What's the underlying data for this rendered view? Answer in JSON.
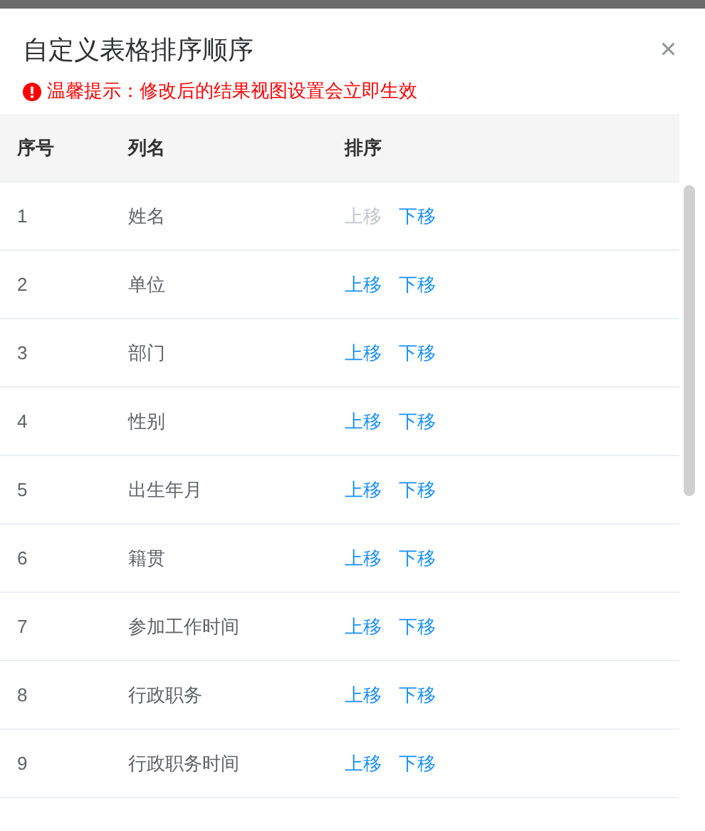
{
  "dialog": {
    "title": "自定义表格排序顺序",
    "close": "×",
    "notice": "温馨提示：修改后的结果视图设置会立即生效"
  },
  "table": {
    "columns": [
      "序号",
      "列名",
      "排序"
    ],
    "rows": [
      {
        "index": "1",
        "name": "姓名",
        "up": {
          "label": "上移",
          "disabled": true
        },
        "down": {
          "label": "下移",
          "disabled": false
        }
      },
      {
        "index": "2",
        "name": "单位",
        "up": {
          "label": "上移",
          "disabled": false
        },
        "down": {
          "label": "下移",
          "disabled": false
        }
      },
      {
        "index": "3",
        "name": "部门",
        "up": {
          "label": "上移",
          "disabled": false
        },
        "down": {
          "label": "下移",
          "disabled": false
        }
      },
      {
        "index": "4",
        "name": "性别",
        "up": {
          "label": "上移",
          "disabled": false
        },
        "down": {
          "label": "下移",
          "disabled": false
        }
      },
      {
        "index": "5",
        "name": "出生年月",
        "up": {
          "label": "上移",
          "disabled": false
        },
        "down": {
          "label": "下移",
          "disabled": false
        }
      },
      {
        "index": "6",
        "name": "籍贯",
        "up": {
          "label": "上移",
          "disabled": false
        },
        "down": {
          "label": "下移",
          "disabled": false
        }
      },
      {
        "index": "7",
        "name": "参加工作时间",
        "up": {
          "label": "上移",
          "disabled": false
        },
        "down": {
          "label": "下移",
          "disabled": false
        }
      },
      {
        "index": "8",
        "name": "行政职务",
        "up": {
          "label": "上移",
          "disabled": false
        },
        "down": {
          "label": "下移",
          "disabled": false
        }
      },
      {
        "index": "9",
        "name": "行政职务时间",
        "up": {
          "label": "上移",
          "disabled": false
        },
        "down": {
          "label": "下移",
          "disabled": false
        }
      }
    ]
  }
}
